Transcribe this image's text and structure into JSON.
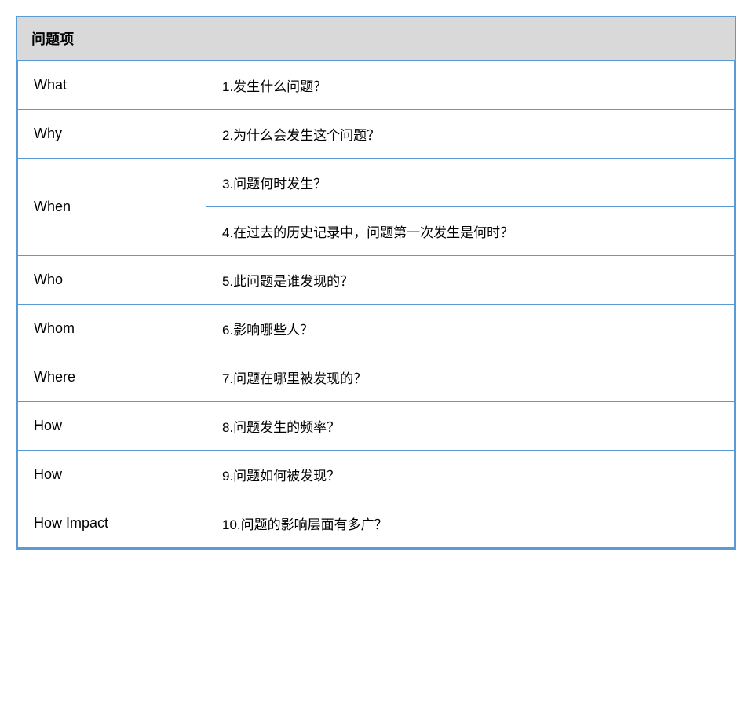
{
  "header": {
    "title": "问题项"
  },
  "rows": [
    {
      "label": "What",
      "items": [
        "1.发生什么问题？"
      ]
    },
    {
      "label": "Why",
      "items": [
        "2.为什么会发生这个问题？"
      ]
    },
    {
      "label": "When",
      "items": [
        "3.问题何时发生？",
        "4.在过去的历史记录中，问题第一次发生是何时？"
      ]
    },
    {
      "label": "Who",
      "items": [
        "5.此问题是谁发现的？"
      ]
    },
    {
      "label": "Whom",
      "items": [
        "6.影响哪些人？"
      ]
    },
    {
      "label": "Where",
      "items": [
        "7.问题在哪里被发现的？"
      ]
    },
    {
      "label": "How",
      "items": [
        "8.问题发生的频率？"
      ]
    },
    {
      "label": "How",
      "items": [
        "9.问题如何被发现？"
      ]
    },
    {
      "label": "How Impact",
      "items": [
        "10.问题的影响层面有多广？"
      ]
    }
  ]
}
